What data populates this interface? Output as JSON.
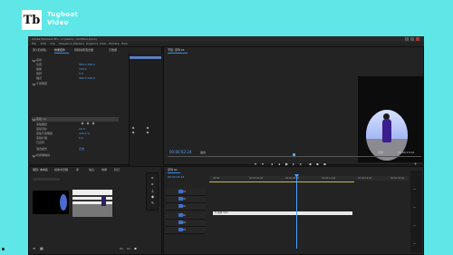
{
  "brand": {
    "logo_text": "Tb",
    "name_line1": "Tugboat",
    "name_line2": "Video"
  },
  "app": {
    "title": "Adobe Premiere Pro - C:\\Users\\...\\Untitled.prproj",
    "menu": [
      "File",
      "Edit",
      "Clip",
      "Sequence",
      "Markers",
      "Graphics",
      "View",
      "Window",
      "Help"
    ],
    "effect_controls_tabs": [
      "源:(无剪辑)",
      "效果控件",
      "音频剪辑混合器",
      "元数据"
    ],
    "program_tab": "节目: 序列 01",
    "project_tabs": [
      "项目: 未命名",
      "媒体浏览器",
      "库",
      "信息",
      "效果",
      "标记"
    ],
    "timeline_tab": "序列 01",
    "timecode_program": "00:00:02:24",
    "timecode_end": "00:00:13:04",
    "fit_label": "适合",
    "quality_label": "完整",
    "timeline_timecode": "00:00:02:24",
    "ruler_ticks": [
      "00:00",
      "00:00:04:00",
      "00:00:08:00",
      "00:00:12:00",
      "00:00:16:00",
      "00:00:20:00"
    ],
    "clip_label": "fx 视频.mp4"
  },
  "effects": {
    "rows": [
      {
        "label": "运动",
        "value": ""
      },
      {
        "label": "位置",
        "value": "960.0 540.0"
      },
      {
        "label": "缩放",
        "value": "100.0"
      },
      {
        "label": "旋转",
        "value": "0.0"
      },
      {
        "label": "锚点",
        "value": "960.0 540.0"
      },
      {
        "label": "不透明度",
        "value": ""
      },
      {
        "label": "蒙版 (1)",
        "value": ""
      },
      {
        "label": "蒙版路径",
        "value": ""
      },
      {
        "label": "蒙版羽化",
        "value": "10.0"
      },
      {
        "label": "蒙版不透明度",
        "value": "100.0 %"
      },
      {
        "label": "蒙版扩展",
        "value": "0.0"
      },
      {
        "label": "已反转",
        "value": ""
      },
      {
        "label": "混合模式",
        "value": "正常"
      },
      {
        "label": "时间重映射",
        "value": ""
      }
    ]
  },
  "tracks": {
    "video": [
      "V3",
      "V2",
      "V1"
    ],
    "audio": [
      "A1",
      "A2",
      "A3"
    ]
  },
  "colors": {
    "background": "#5fe6e6",
    "app_bg": "#1b1b1b",
    "accent": "#2d8ceb"
  }
}
